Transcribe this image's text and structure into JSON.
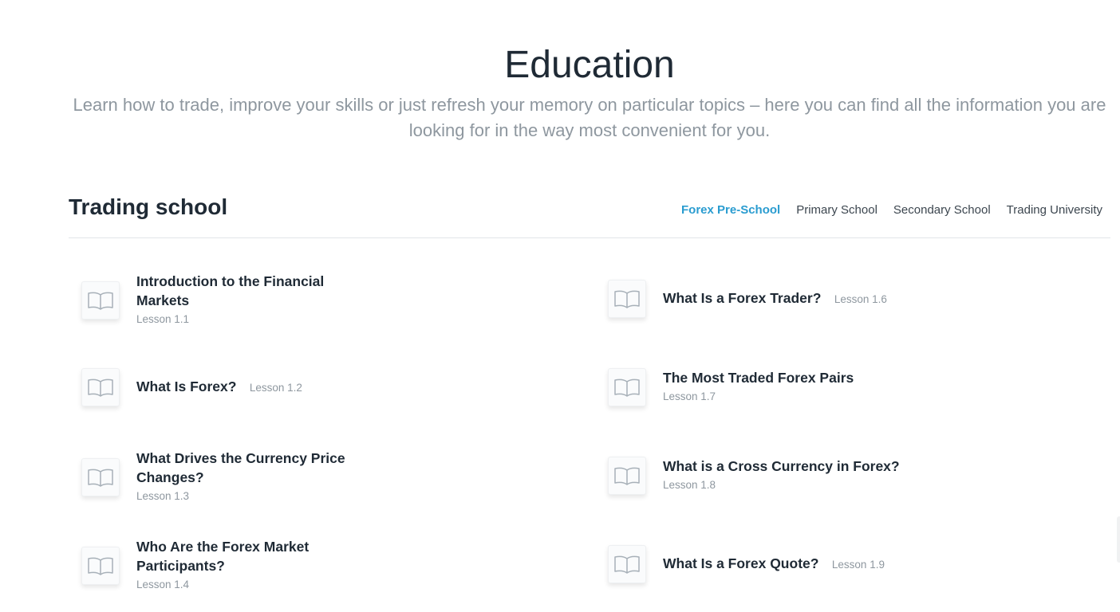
{
  "hero": {
    "title": "Education",
    "subtitle": "Learn how to trade, improve your skills or just refresh your memory on particular topics – here you can find all the information you are looking for in the way most convenient for you."
  },
  "school": {
    "title": "Trading school",
    "tabs": [
      {
        "label": "Forex Pre-School",
        "active": true
      },
      {
        "label": "Primary School",
        "active": false
      },
      {
        "label": "Secondary School",
        "active": false
      },
      {
        "label": "Trading University",
        "active": false
      }
    ],
    "accent_color": "#2a9cd0"
  },
  "lessons": [
    {
      "title": "Introduction to the Financial Markets",
      "number": "Lesson 1.1"
    },
    {
      "title": "What Is Forex?",
      "number": "Lesson 1.2"
    },
    {
      "title": "What Drives the Currency Price Changes?",
      "number": "Lesson 1.3"
    },
    {
      "title": "Who Are the Forex Market Participants?",
      "number": "Lesson 1.4"
    },
    {
      "title": "What Is a Forex Trader?",
      "number": "Lesson 1.6"
    },
    {
      "title": "The Most Traded Forex Pairs",
      "number": "Lesson 1.7"
    },
    {
      "title": "What is a Cross Currency in Forex?",
      "number": "Lesson 1.8"
    },
    {
      "title": "What Is a Forex Quote?",
      "number": "Lesson 1.9"
    }
  ],
  "icons": {
    "lesson": "open-book-icon"
  }
}
